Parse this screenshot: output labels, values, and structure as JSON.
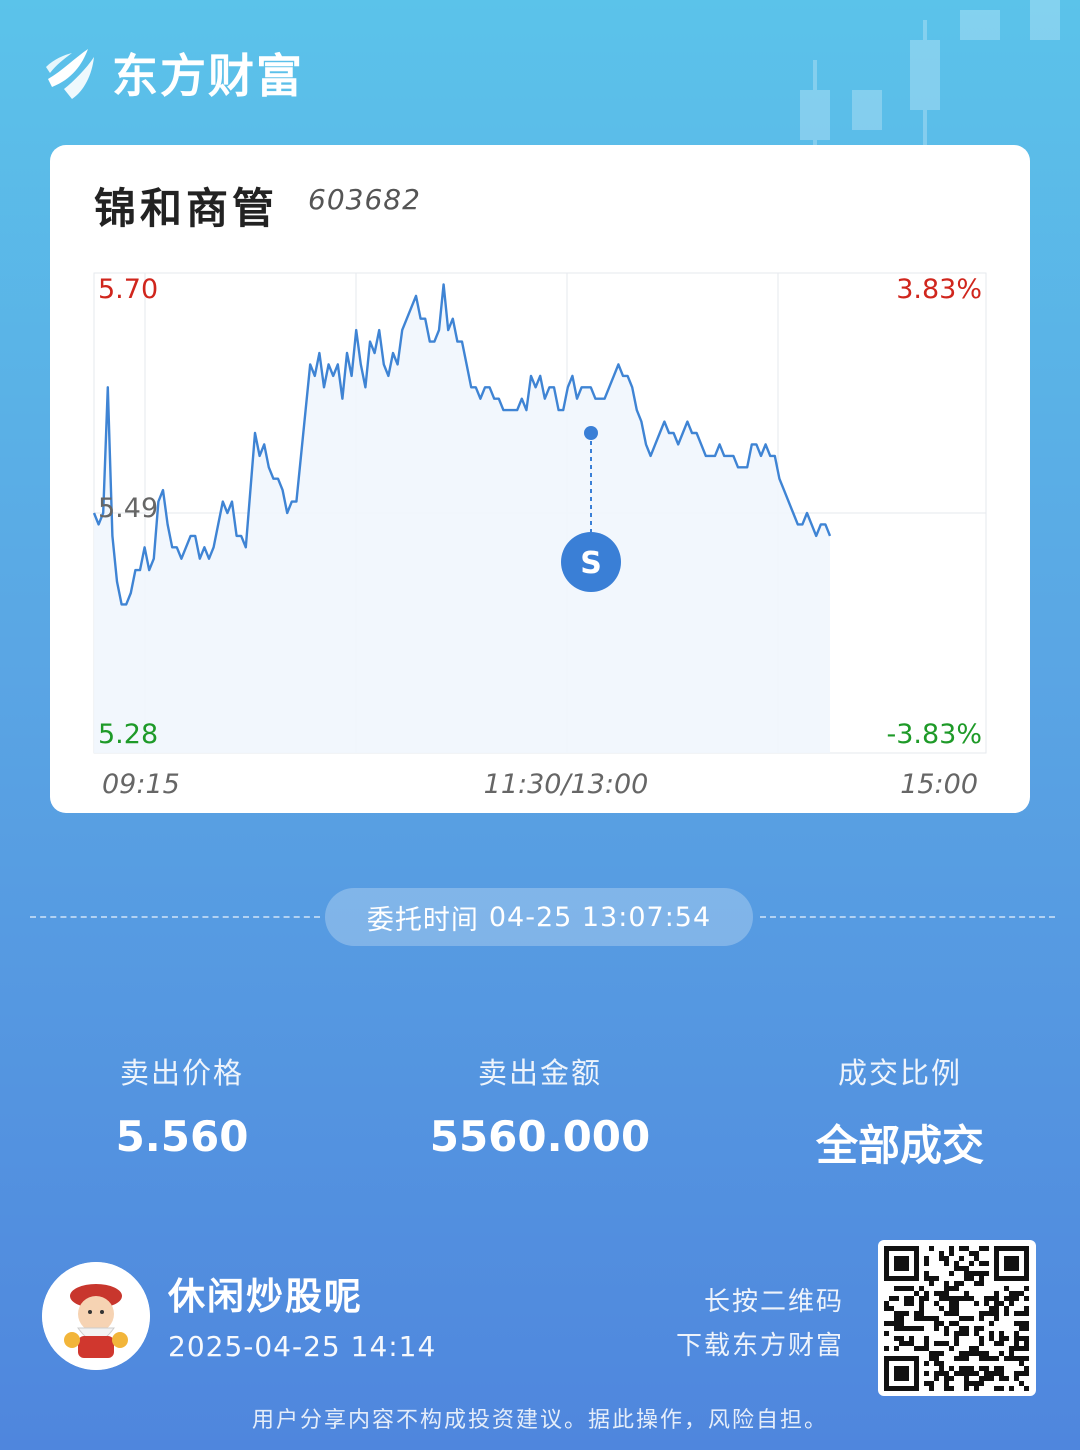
{
  "brand": {
    "name": "东方财富",
    "logo_icon": "eastmoney-logo-icon"
  },
  "stock": {
    "name": "锦和商管",
    "code": "603682"
  },
  "chart_data": {
    "type": "line",
    "y_axis": {
      "top_price": "5.70",
      "mid_price": "5.49",
      "bottom_price": "5.28",
      "top_pct": "3.83%",
      "bottom_pct": "-3.83%",
      "ylim": [
        5.28,
        5.7
      ]
    },
    "x_axis": {
      "start": "09:15",
      "mid": "11:30/13:00",
      "end": "15:00"
    },
    "series": [
      {
        "values": [
          5.49,
          5.48,
          5.49,
          5.6,
          5.47,
          5.43,
          5.41,
          5.41,
          5.42,
          5.44,
          5.44,
          5.46,
          5.44,
          5.45,
          5.5,
          5.51,
          5.48,
          5.46,
          5.46,
          5.45,
          5.46,
          5.47,
          5.47,
          5.45,
          5.46,
          5.45,
          5.46,
          5.48,
          5.5,
          5.49,
          5.5,
          5.47,
          5.47,
          5.46,
          5.51,
          5.56,
          5.54,
          5.55,
          5.53,
          5.52,
          5.52,
          5.51,
          5.49,
          5.5,
          5.5,
          5.54,
          5.58,
          5.62,
          5.61,
          5.63,
          5.6,
          5.62,
          5.61,
          5.62,
          5.59,
          5.63,
          5.61,
          5.65,
          5.62,
          5.6,
          5.64,
          5.63,
          5.65,
          5.62,
          5.61,
          5.63,
          5.62,
          5.65,
          5.66,
          5.67,
          5.68,
          5.66,
          5.66,
          5.64,
          5.64,
          5.65,
          5.69,
          5.65,
          5.66,
          5.64,
          5.64,
          5.62,
          5.6,
          5.6,
          5.59,
          5.6,
          5.6,
          5.59,
          5.59,
          5.58,
          5.58,
          5.58,
          5.58,
          5.59,
          5.58,
          5.61,
          5.6,
          5.61,
          5.59,
          5.6,
          5.6,
          5.58,
          5.58,
          5.6,
          5.61,
          5.59,
          5.6,
          5.6,
          5.6,
          5.59,
          5.59,
          5.59,
          5.6,
          5.61,
          5.62,
          5.61,
          5.61,
          5.6,
          5.58,
          5.57,
          5.55,
          5.54,
          5.55,
          5.56,
          5.57,
          5.56,
          5.56,
          5.55,
          5.56,
          5.57,
          5.56,
          5.56,
          5.55,
          5.54,
          5.54,
          5.54,
          5.55,
          5.54,
          5.54,
          5.54,
          5.53,
          5.53,
          5.53,
          5.55,
          5.55,
          5.54,
          5.55,
          5.54,
          5.54,
          5.52,
          5.51,
          5.5,
          5.49,
          5.48,
          5.48,
          5.49,
          5.48,
          5.47,
          5.48,
          5.48,
          5.47
        ],
        "point_note": "series covers 09:15 through ~14:20"
      }
    ],
    "markers": [
      {
        "label": "S",
        "time": "13:07",
        "price": 5.56
      }
    ],
    "grid": true
  },
  "order": {
    "label": "委托时间",
    "datetime": "04-25 13:07:54"
  },
  "stats": [
    {
      "label": "卖出价格",
      "value": "5.560"
    },
    {
      "label": "卖出金额",
      "value": "5560.000"
    },
    {
      "label": "成交比例",
      "value": "全部成交"
    }
  ],
  "user": {
    "name": "休闲炒股呢",
    "time": "2025-04-25 14:14"
  },
  "qr": {
    "hint_line1": "长按二维码",
    "hint_line2": "下载东方财富"
  },
  "disclaimer": "用户分享内容不构成投资建议。据此操作，风险自担。",
  "colors": {
    "up": "#d0261d",
    "down": "#1e9a28",
    "line": "#3f84d4",
    "marker": "#3a7fd6"
  }
}
